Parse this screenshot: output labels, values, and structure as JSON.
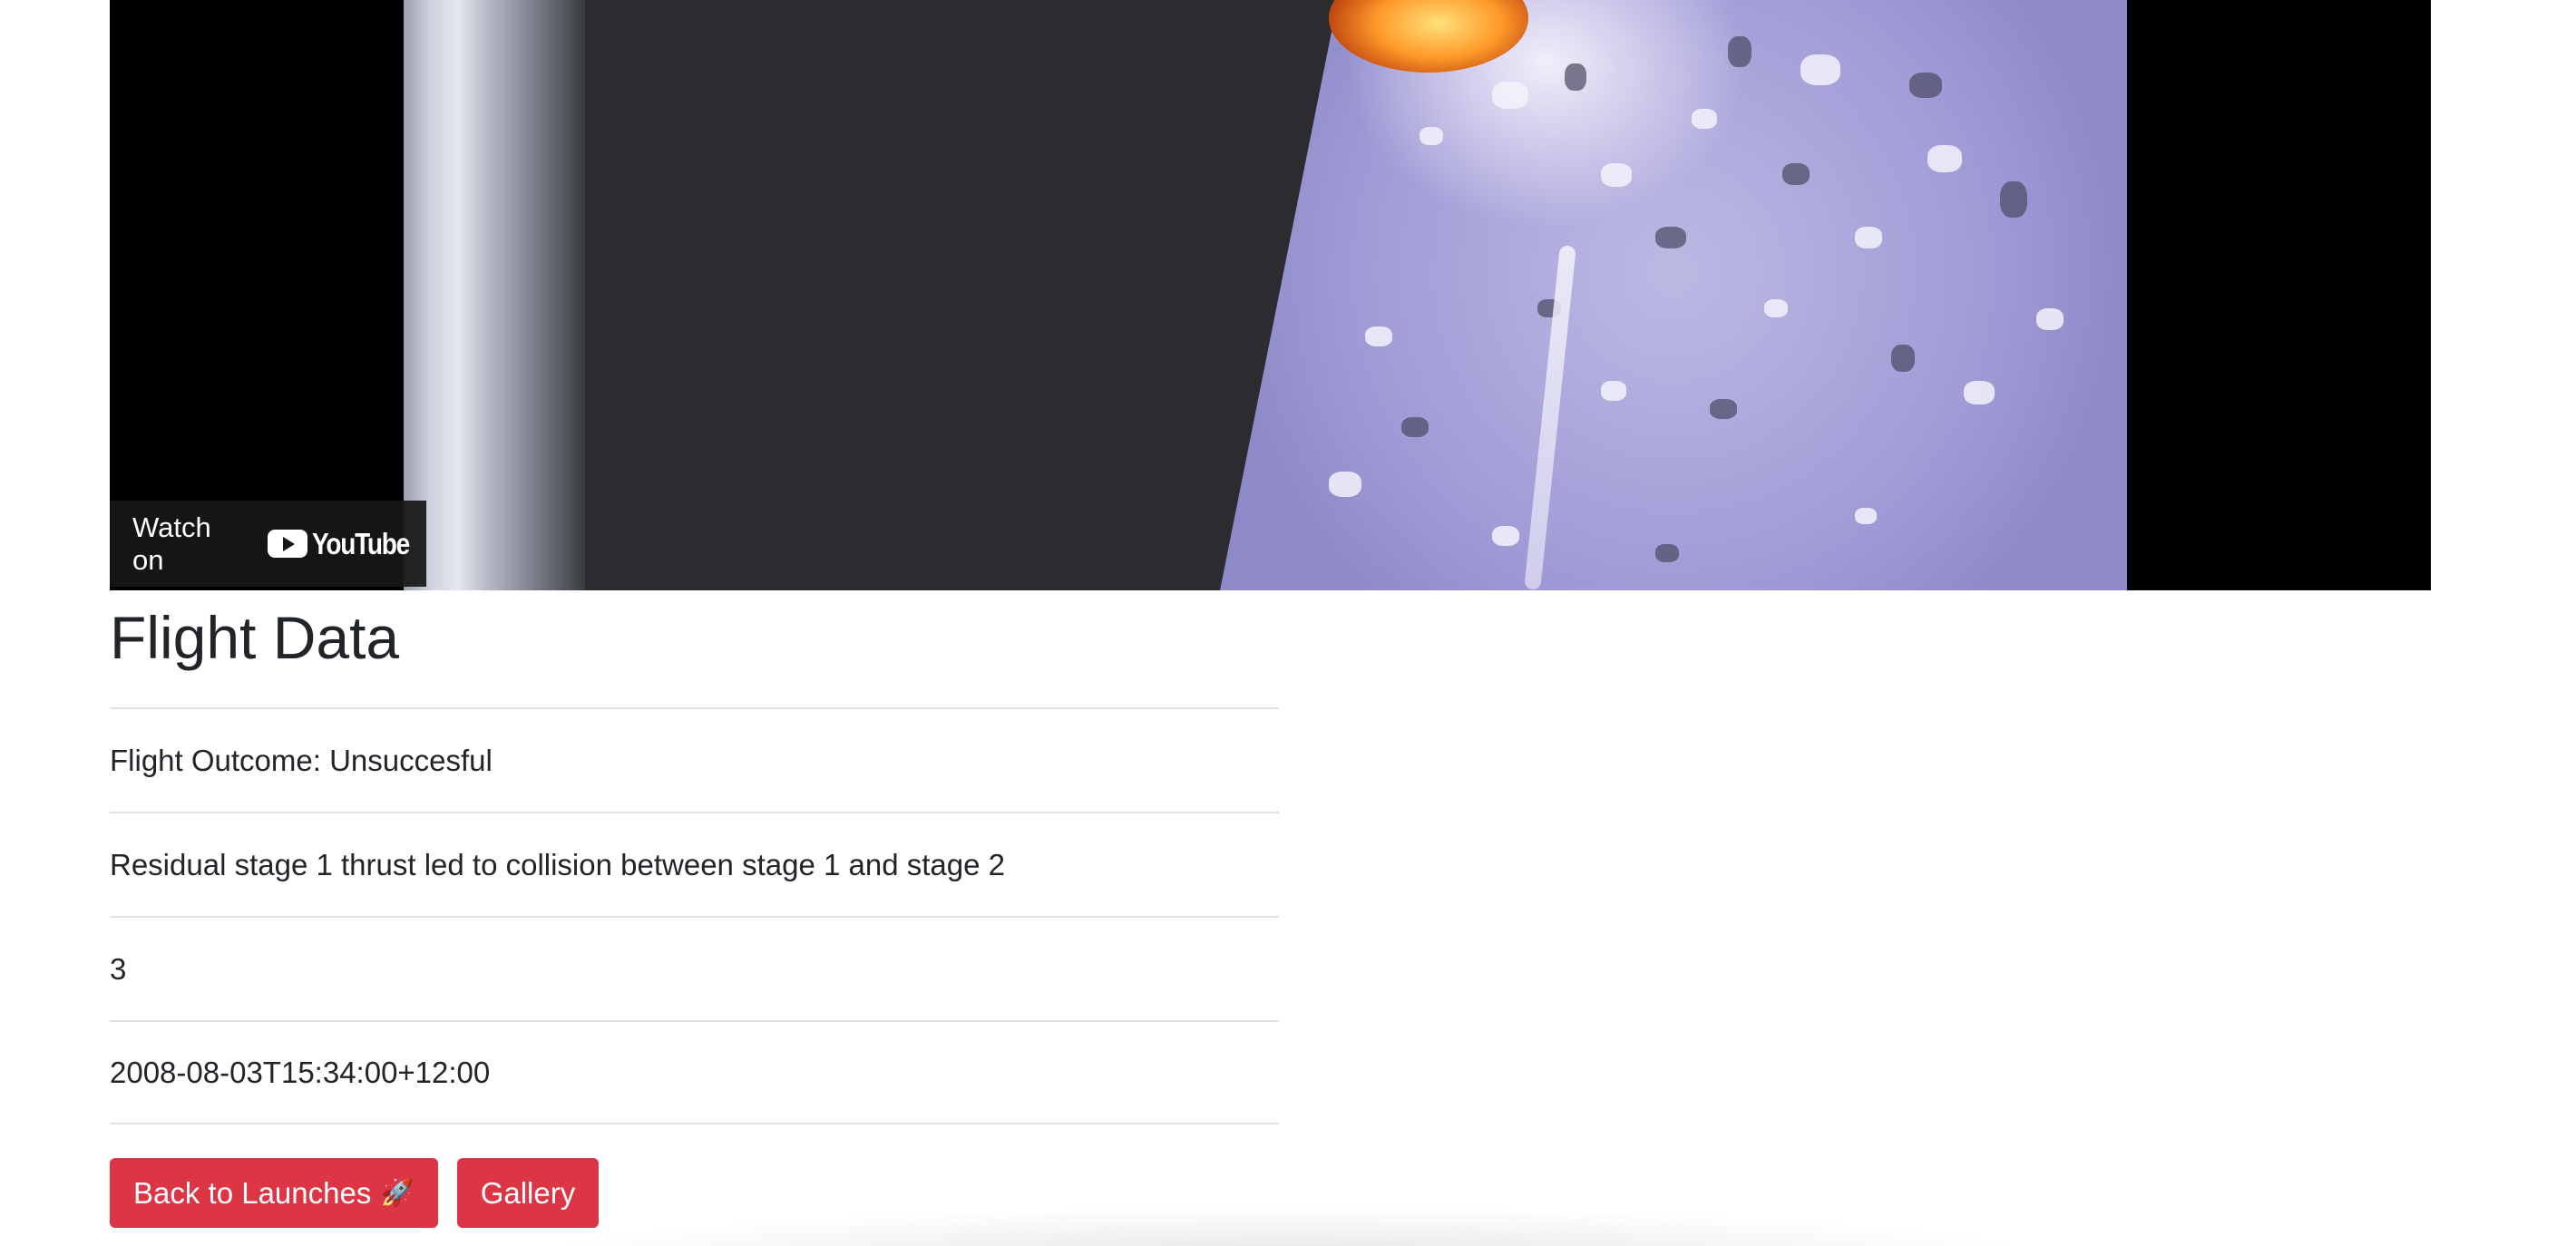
{
  "video": {
    "watch_label": "Watch on",
    "youtube_wordmark": "YouTube",
    "icon": "youtube-play-icon"
  },
  "flight": {
    "heading": "Flight Data",
    "rows": [
      "Flight Outcome: Unsuccesful",
      "Residual stage 1 thrust led to collision between stage 1 and stage 2",
      "3",
      "2008-08-03T15:34:00+12:00"
    ]
  },
  "actions": {
    "back_label": "Back to Launches",
    "back_icon": "🚀",
    "gallery_label": "Gallery"
  },
  "colors": {
    "button_bg": "#dc3545",
    "divider": "#dee2e6",
    "text": "#212529"
  }
}
